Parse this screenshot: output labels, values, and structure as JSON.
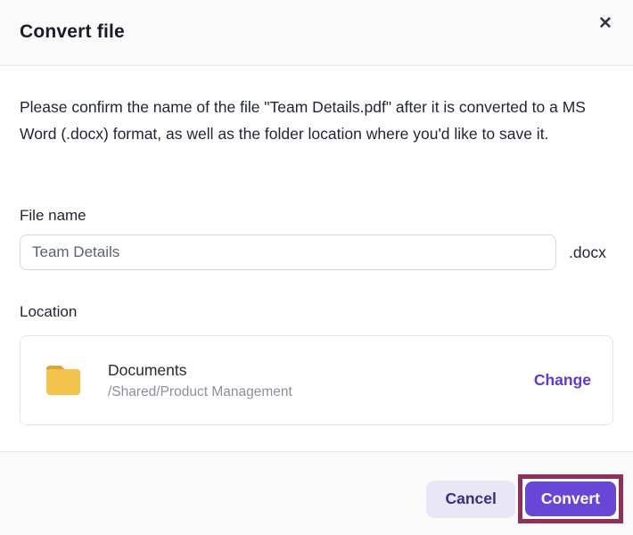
{
  "modal": {
    "title": "Convert file",
    "description": "Please confirm the name of the file \"Team Details.pdf\" after it is converted to a MS Word (.docx) format, as well as the folder location where you'd like to save it.",
    "file_name": {
      "label": "File name",
      "value": "Team Details",
      "extension_suffix": ".docx"
    },
    "location": {
      "label": "Location",
      "folder_name": "Documents",
      "folder_path": "/Shared/Product Management",
      "change_label": "Change"
    },
    "footer": {
      "cancel_label": "Cancel",
      "convert_label": "Convert"
    }
  },
  "icons": {
    "close": "✕",
    "folder": "folder-icon"
  },
  "colors": {
    "accent_purple": "#6847d6",
    "link_purple": "#6238ce",
    "cancel_bg": "#e9e6f5",
    "cancel_text": "#3c2d80",
    "folder_yellow": "#f2c44d",
    "folder_tab_yellow": "#d9a53f",
    "annotation_highlight": "#8e3157",
    "header_footer_bg": "#fafafa"
  }
}
